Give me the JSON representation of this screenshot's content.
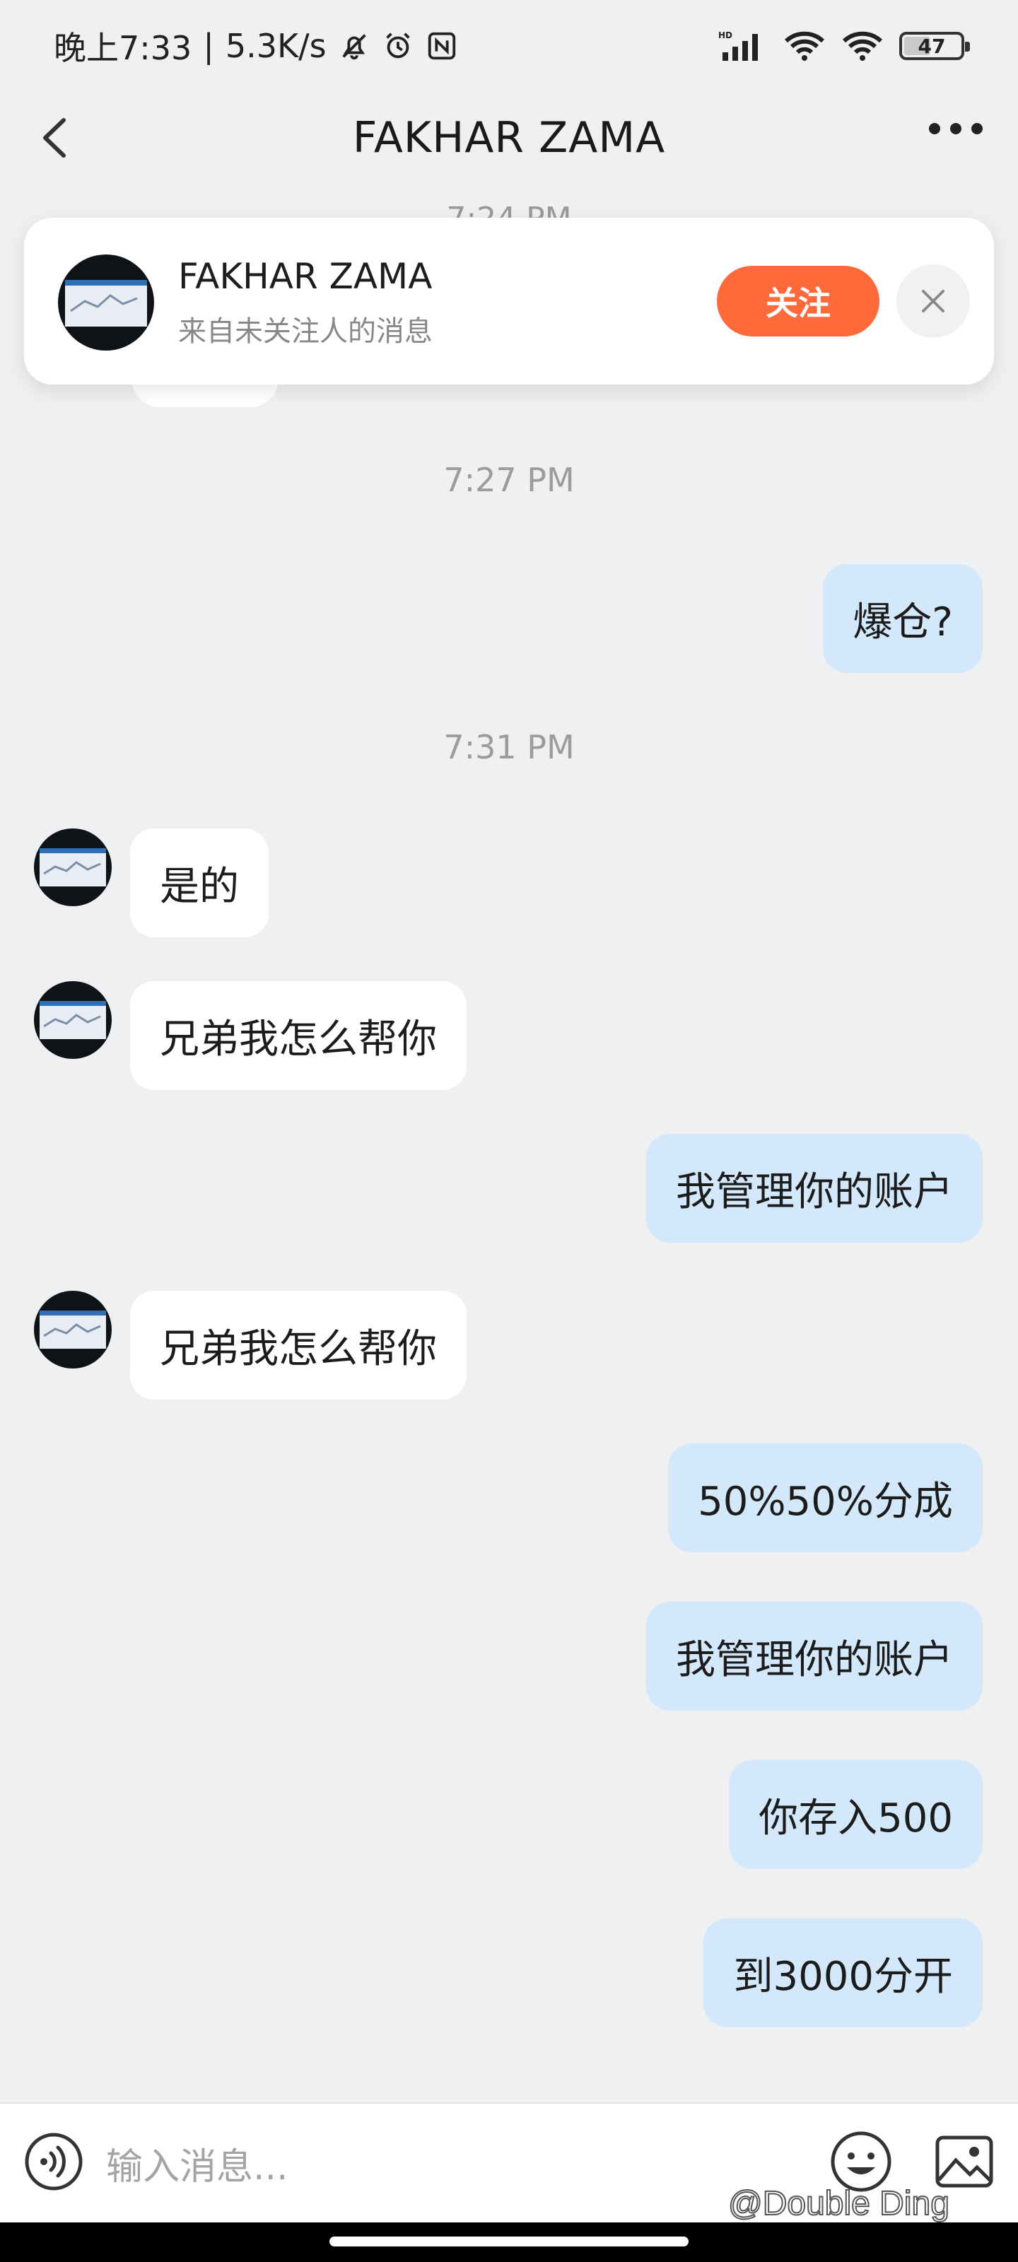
{
  "status_bar": {
    "time": "晚上7:33",
    "separator": "|",
    "speed": "5.3K/s",
    "battery": "47",
    "hd_label": "HD"
  },
  "header": {
    "title": "FAKHAR ZAMA"
  },
  "follow_card": {
    "name": "FAKHAR ZAMA",
    "subtitle": "来自未关注人的消息",
    "follow_label": "关注"
  },
  "chat": {
    "faded_time": "7:24 PM",
    "times": [
      "7:27 PM",
      "7:31 PM"
    ],
    "messages": [
      {
        "side": "out",
        "text": "爆仓?"
      },
      {
        "side": "in",
        "text": "是的"
      },
      {
        "side": "in",
        "text": "兄弟我怎么帮你"
      },
      {
        "side": "out",
        "text": "我管理你的账户"
      },
      {
        "side": "in",
        "text": "兄弟我怎么帮你"
      },
      {
        "side": "out",
        "text": "50%50%分成"
      },
      {
        "side": "out",
        "text": "我管理你的账户"
      },
      {
        "side": "out",
        "text": "你存入500"
      },
      {
        "side": "out",
        "text": "到3000分开"
      }
    ]
  },
  "input": {
    "placeholder": "输入消息..."
  },
  "watermark": "@Double Ding",
  "colors": {
    "follow_button": "#ff6a3a",
    "outgoing_bubble": "#d3e8fb",
    "incoming_bubble": "#ffffff",
    "background": "#eff0f2"
  },
  "icons": [
    "back-icon",
    "more-icon",
    "close-icon",
    "voice-icon",
    "emoji-icon",
    "image-icon",
    "mute-icon",
    "alarm-icon",
    "nfc-icon",
    "signal-icon",
    "wifi-icon",
    "battery-icon"
  ]
}
